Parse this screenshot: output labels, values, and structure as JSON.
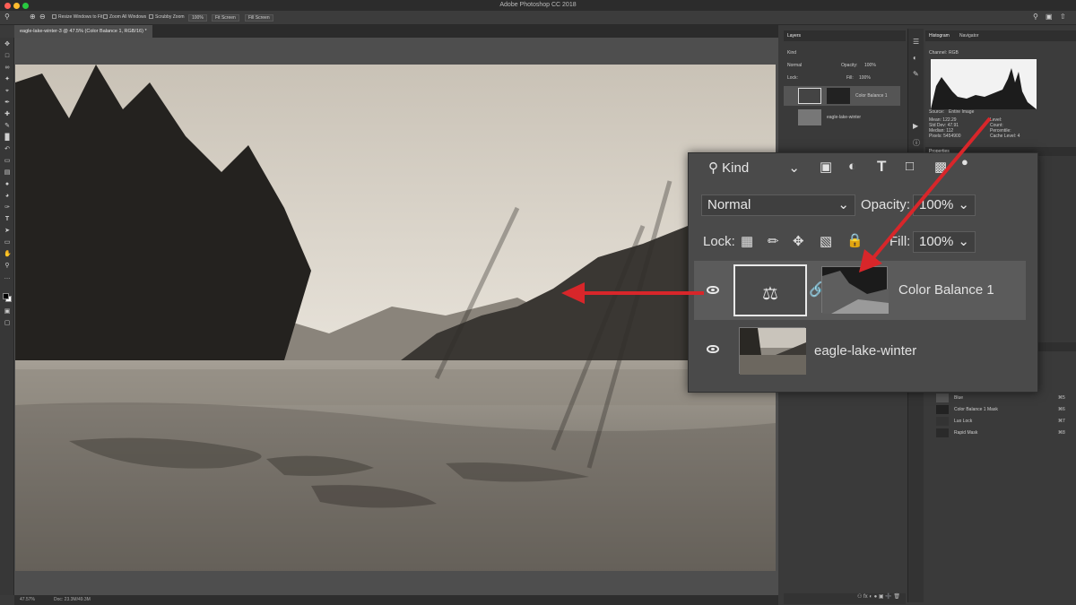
{
  "window": {
    "title": "Adobe Photoshop CC 2018",
    "traffic_colors": [
      "#ff5f57",
      "#febc2e",
      "#28c840"
    ]
  },
  "options_bar": {
    "resize_windows": "Resize Windows to Fit",
    "zoom_all_windows": "Zoom All Windows",
    "scrubby_zoom": "Scrubby Zoom",
    "zoom_100": "100%",
    "fit_screen": "Fit Screen",
    "fill_screen": "Fill Screen"
  },
  "document": {
    "tab_label": "eagle-lake-winter-3 @ 47.5% (Color Balance 1, RGB/16) *",
    "zoom_status": "47.57%",
    "doc_size": "Doc: 23.3M/49.3M"
  },
  "layers_small": {
    "tab": "Layers",
    "kind": "Kind",
    "blend": "Normal",
    "opacity_label": "Opacity:",
    "opacity": "100%",
    "lock_label": "Lock:",
    "fill_label": "Fill:",
    "fill": "100%",
    "layers": [
      "Color Balance 1",
      "eagle-lake-winter"
    ]
  },
  "histogram": {
    "tabs": [
      "Histogram",
      "Navigator"
    ],
    "channel_label": "Channel:",
    "channel": "RGB",
    "source_label": "Source:",
    "source": "Entire Image",
    "stats_left": [
      "Mean:",
      "Std Dev:",
      "Median:",
      "Pixels:"
    ],
    "stats_left_vals": [
      "122.29",
      "47.91",
      "112",
      "5454900"
    ],
    "stats_right": [
      "Level:",
      "Count:",
      "Percentile:",
      "Cache Level:"
    ],
    "stats_right_vals": [
      "",
      "",
      "",
      "4"
    ]
  },
  "properties": {
    "tab": "Properties"
  },
  "channels": {
    "rows": [
      "Blue",
      "Color Balance 1 Mask",
      "Luo Lock",
      "Rapid Mask"
    ],
    "shortcuts": [
      "⌘5",
      "⌘6",
      "⌘7",
      "⌘8"
    ]
  },
  "zoom_callout": {
    "kind": "Kind",
    "blend_mode": "Normal",
    "opacity_label": "Opacity:",
    "opacity": "100%",
    "lock_label": "Lock:",
    "fill_label": "Fill:",
    "fill": "100%",
    "layer_top": "Color Balance 1",
    "layer_bottom": "eagle-lake-winter"
  },
  "annotation_color": "#d8262a"
}
